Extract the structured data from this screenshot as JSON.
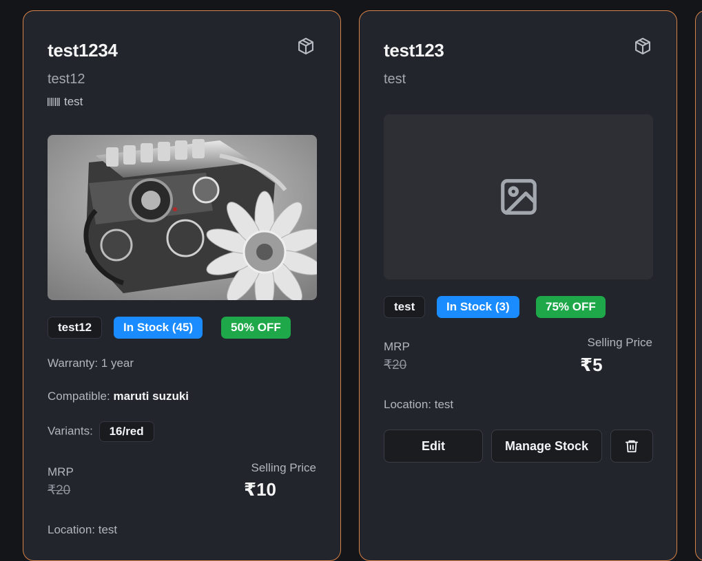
{
  "products": [
    {
      "title": "test1234",
      "subtitle": "test12",
      "sku_icon": "barcode-icon",
      "sku": "test",
      "image": "engine-photo",
      "badges": {
        "brand": "test12",
        "stock": "In Stock (45)",
        "discount": "50% OFF"
      },
      "warranty_label": "Warranty:",
      "warranty_value": "1 year",
      "compatible_label": "Compatible:",
      "compatible_value": "maruti suzuki",
      "variants_label": "Variants:",
      "variant": "16/red",
      "mrp_label": "MRP",
      "mrp": "₹20",
      "selling_label": "Selling Price",
      "selling": "₹10",
      "location": "Location: test"
    },
    {
      "title": "test123",
      "subtitle": "test",
      "image": "image-placeholder-icon",
      "badges": {
        "brand": "test",
        "stock": "In Stock (3)",
        "discount": "75% OFF"
      },
      "mrp_label": "MRP",
      "mrp": "₹20",
      "selling_label": "Selling Price",
      "selling": "₹5",
      "location": "Location: test",
      "actions": {
        "edit": "Edit",
        "manage": "Manage Stock",
        "delete_icon": "trash-icon"
      }
    }
  ],
  "colors": {
    "background": "#141519",
    "card": "#22252c",
    "card_border": "#d9844a",
    "stock_blue": "#1a8cff",
    "discount_green": "#1fa84a"
  }
}
